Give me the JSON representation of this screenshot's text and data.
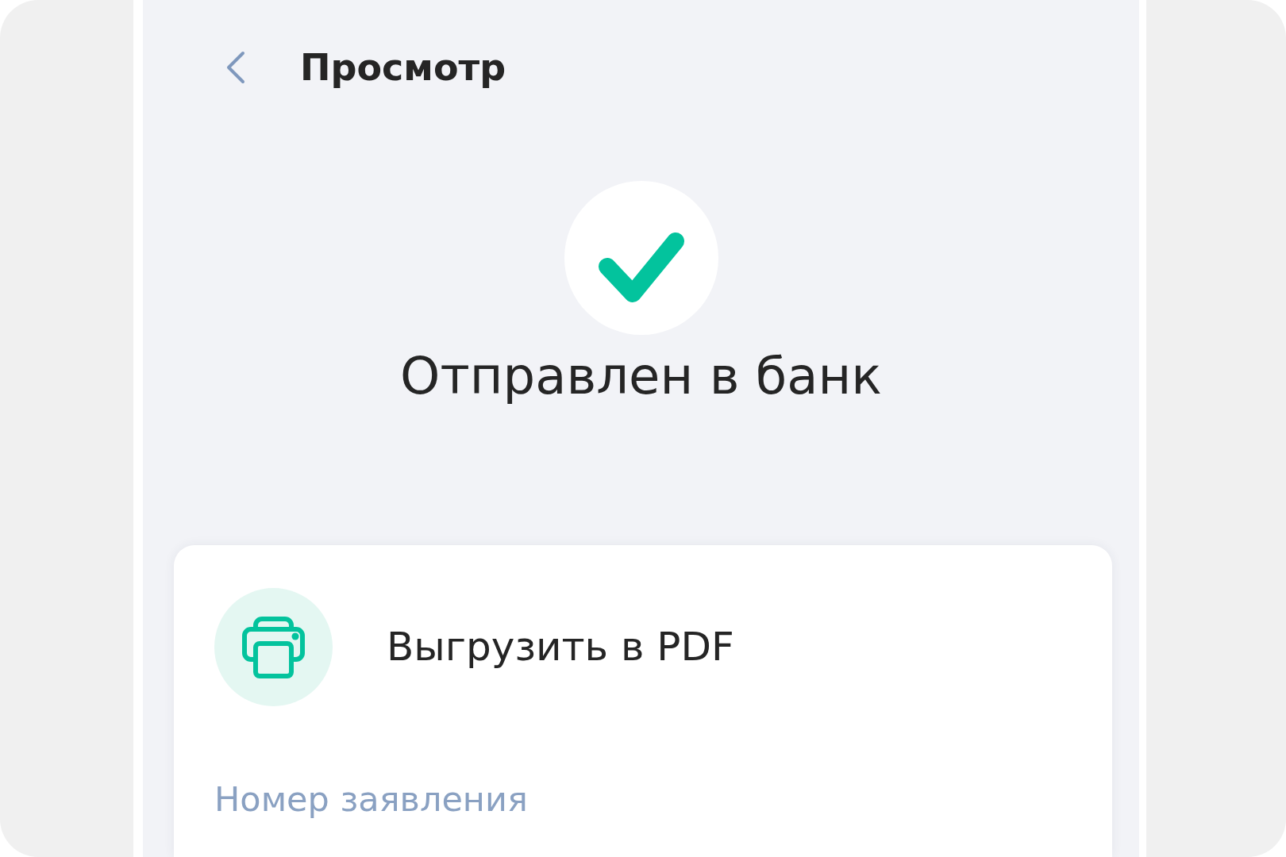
{
  "header": {
    "title": "Просмотр"
  },
  "status": {
    "kind": "success",
    "title": "Отправлен в банк"
  },
  "card": {
    "actions": [
      {
        "kind": "print",
        "label": "Выгрузить в PDF"
      }
    ],
    "fields": [
      {
        "label": "Номер заявления"
      }
    ]
  }
}
